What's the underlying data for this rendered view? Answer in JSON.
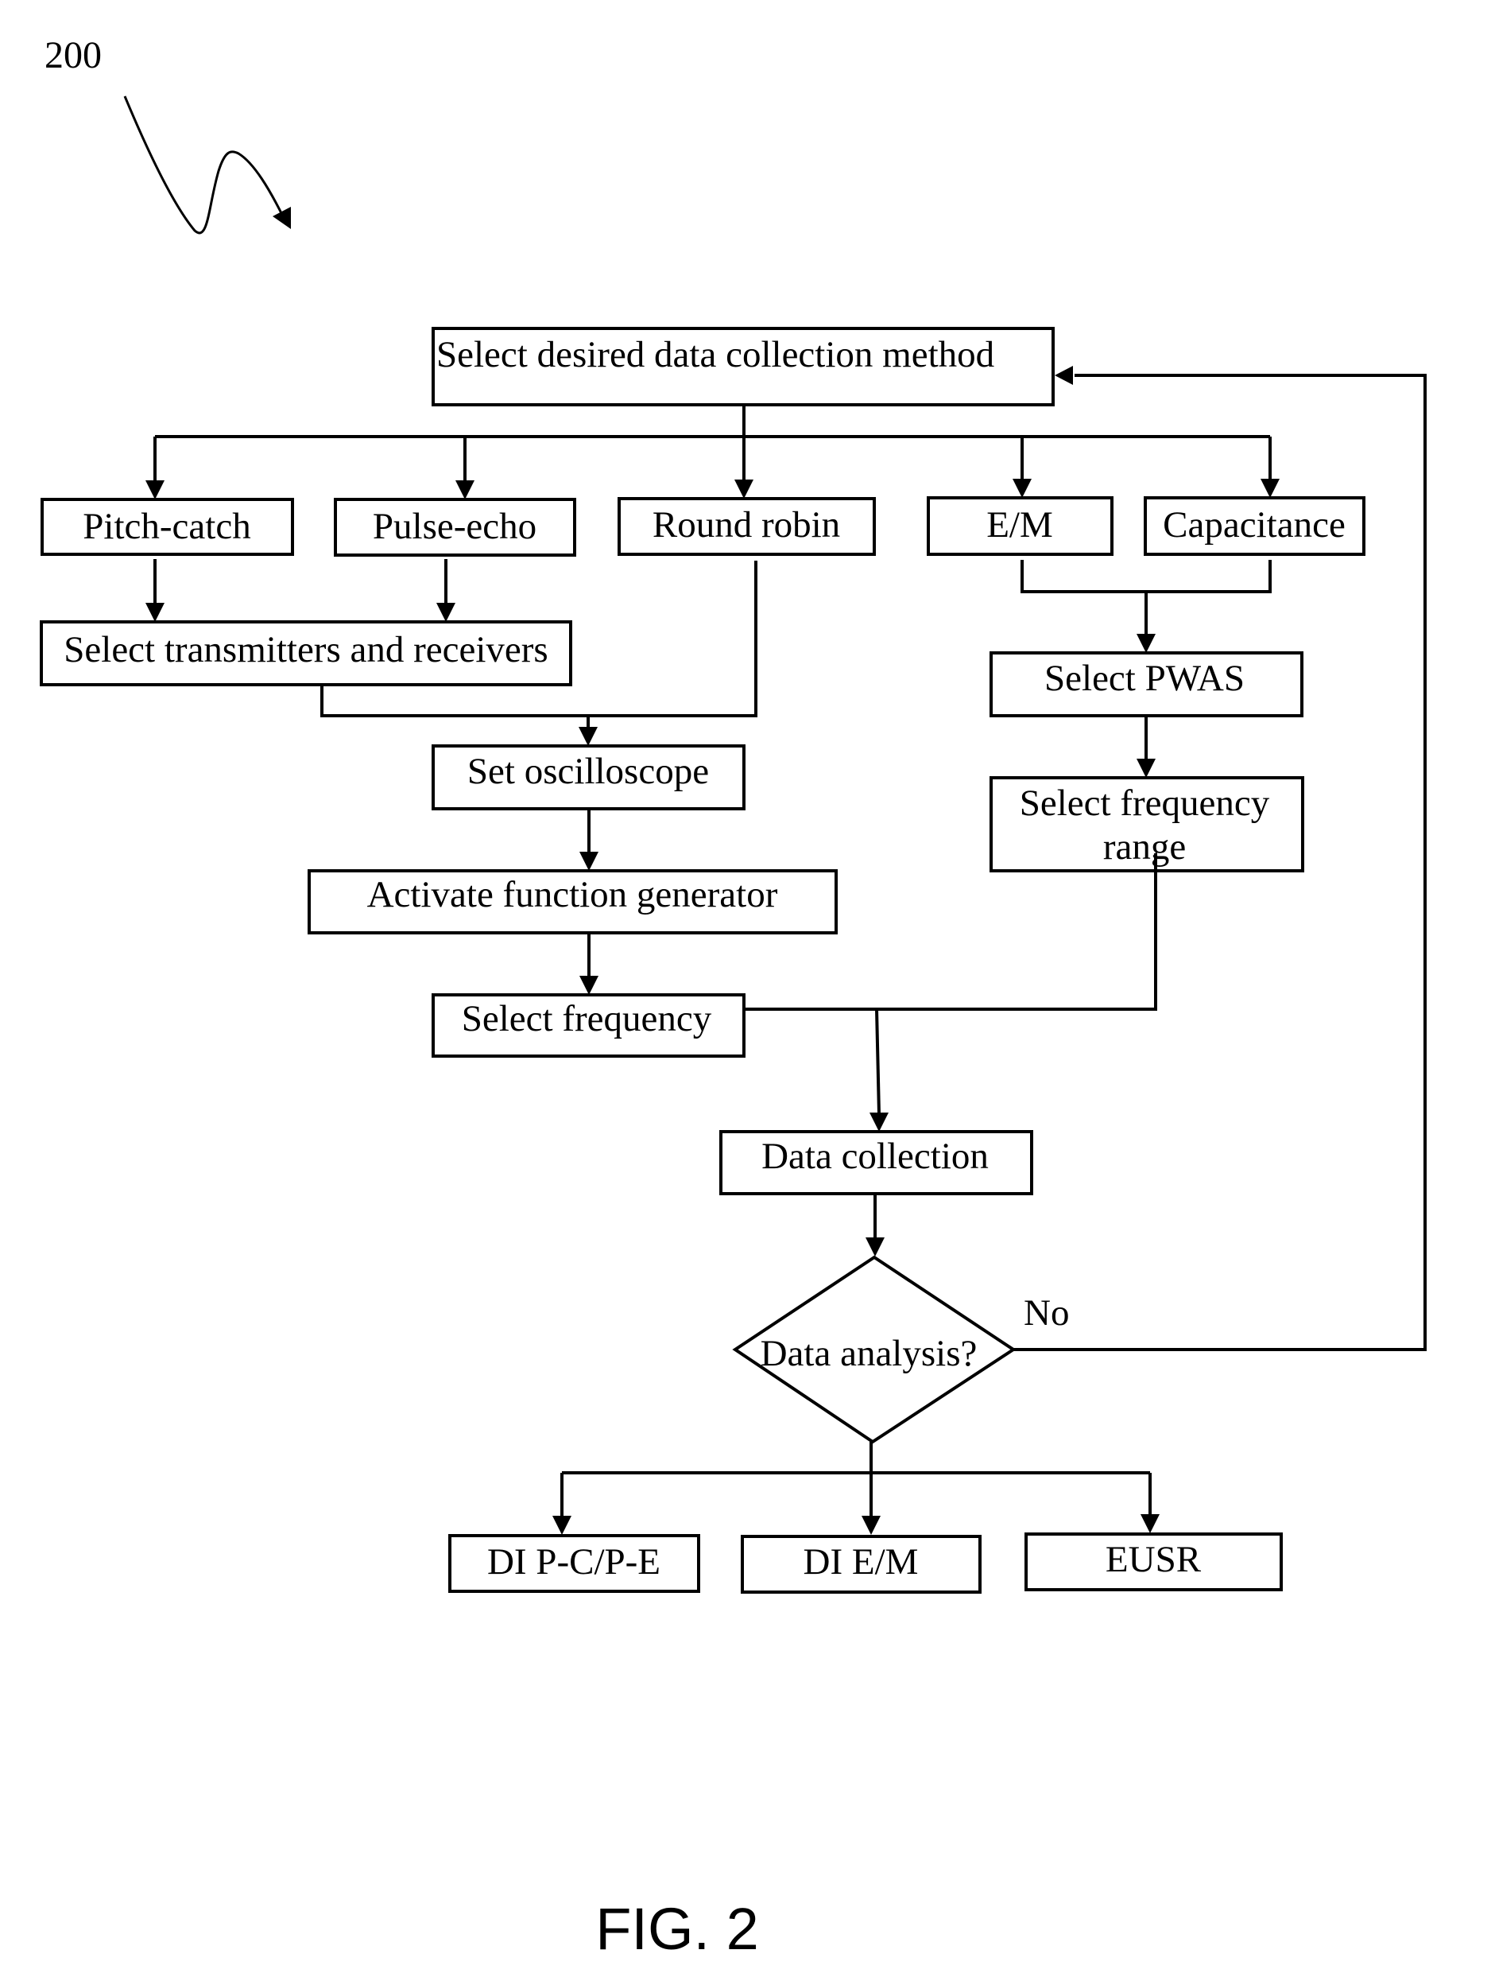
{
  "figure": {
    "reference_numeral": "200",
    "caption": "FIG. 2"
  },
  "flowchart": {
    "start": "Select desired data collection method",
    "methods": {
      "pitch_catch": "Pitch-catch",
      "pulse_echo": "Pulse-echo",
      "round_robin": "Round robin",
      "em": "E/M",
      "capacitance": "Capacitance"
    },
    "select_transducers": "Select transmitters and receivers",
    "set_oscilloscope": "Set oscilloscope",
    "activate_generator": "Activate function generator",
    "select_frequency": "Select frequency",
    "select_pwas": "Select PWAS",
    "select_frequency_range": [
      "Select frequency",
      "range"
    ],
    "data_collection": "Data collection",
    "decision": "Data analysis?",
    "decision_no_label": "No",
    "outcomes": {
      "di_pc_pe": "DI P-C/P-E",
      "di_em": "DI E/M",
      "eusr": "EUSR"
    }
  }
}
